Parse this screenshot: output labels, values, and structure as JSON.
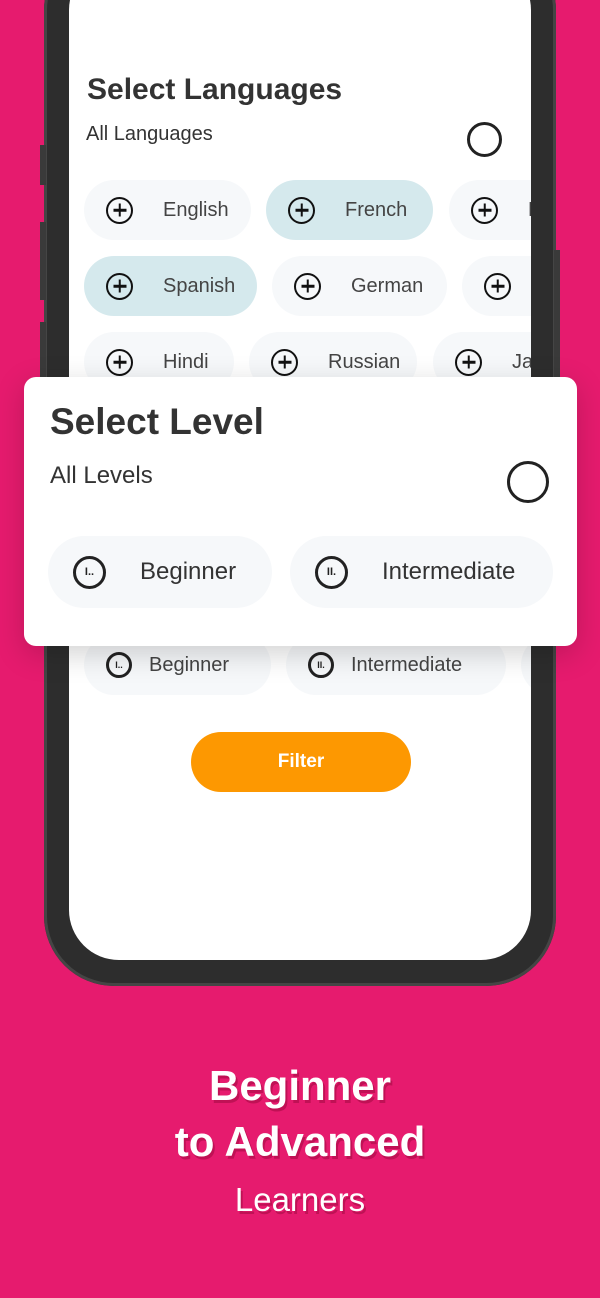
{
  "languages_section": {
    "title": "Select Languages",
    "all_label": "All Languages",
    "all_selected": false,
    "chips": [
      {
        "label": "English",
        "selected": false,
        "icon": "plus-circle-icon"
      },
      {
        "label": "French",
        "selected": true,
        "icon": "plus-circle-icon"
      },
      {
        "label": "E",
        "selected": false,
        "icon": "plus-circle-icon"
      },
      {
        "label": "Spanish",
        "selected": true,
        "icon": "plus-circle-icon"
      },
      {
        "label": "German",
        "selected": false,
        "icon": "plus-circle-icon"
      },
      {
        "label": "",
        "selected": false,
        "icon": "plus-circle-icon"
      },
      {
        "label": "Hindi",
        "selected": false,
        "icon": "plus-circle-icon"
      },
      {
        "label": "Russian",
        "selected": false,
        "icon": "plus-circle-icon"
      },
      {
        "label": "Ja",
        "selected": false,
        "icon": "plus-circle-icon"
      }
    ]
  },
  "levels_background": {
    "chips": [
      {
        "label": "Beginner",
        "icon_text": "I.."
      },
      {
        "label": "Intermediate",
        "icon_text": "II."
      }
    ]
  },
  "level_card": {
    "title": "Select Level",
    "all_label": "All Levels",
    "all_selected": false,
    "chips": [
      {
        "label": "Beginner",
        "icon_text": "I.."
      },
      {
        "label": "Intermediate",
        "icon_text": "II."
      }
    ]
  },
  "filter_button": {
    "label": "Filter",
    "color": "#fd9801"
  },
  "tagline": {
    "line1": "Beginner",
    "line2": "to Advanced",
    "line3": "Learners"
  },
  "colors": {
    "background": "#e61b6e",
    "chip_selected": "#d5e9ed",
    "chip_default": "#f6f8fa"
  }
}
